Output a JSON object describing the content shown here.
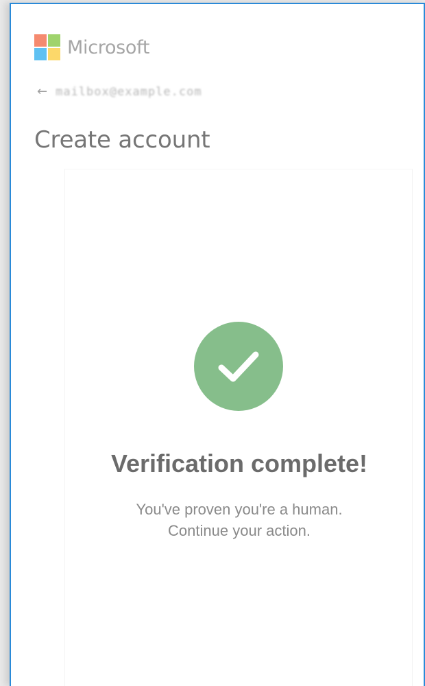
{
  "brand": {
    "name": "Microsoft",
    "logo_colors": [
      "#f58a6f",
      "#9fd36c",
      "#5fc1f2",
      "#fcd86a"
    ]
  },
  "header": {
    "back_icon": "back-arrow-icon",
    "identity_text": "mailbox@example.com"
  },
  "page": {
    "title": "Create account"
  },
  "verification": {
    "status_icon": "checkmark-icon",
    "status_color": "#86be8b",
    "title": "Verification complete!",
    "message_line1": "You've proven you're a human.",
    "message_line2": "Continue your action."
  },
  "colors": {
    "accent_border": "#2a8ad8"
  }
}
